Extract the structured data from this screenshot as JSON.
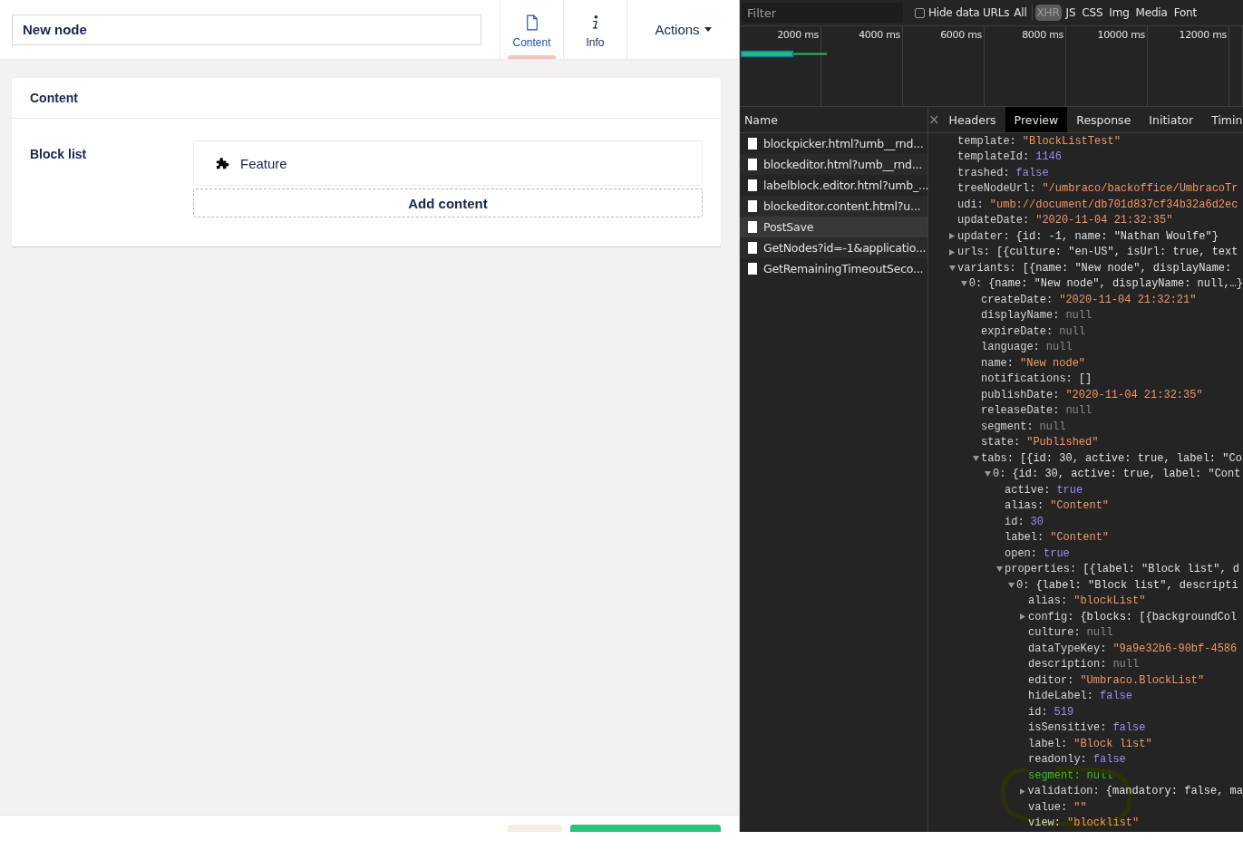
{
  "editor": {
    "name_field": {
      "value": "New node"
    },
    "tabs": [
      {
        "label": "Content",
        "selected": true
      },
      {
        "label": "Info",
        "selected": false
      }
    ],
    "actions_button": "Actions",
    "group": {
      "title": "Content",
      "property": {
        "label": "Block list",
        "blocks": [
          {
            "label": "Feature"
          }
        ],
        "add_button": "Add content"
      }
    },
    "footer_buttons": [
      {
        "kind": "secondary"
      },
      {
        "kind": "primary"
      }
    ]
  },
  "devtools": {
    "filter": {
      "placeholder": "Filter"
    },
    "hide_data_urls": {
      "label": "Hide data URLs",
      "checked": false
    },
    "type_filters": [
      {
        "label": "All",
        "selected": false
      },
      {
        "label": "XHR",
        "selected": true
      },
      {
        "label": "JS",
        "selected": false
      },
      {
        "label": "CSS",
        "selected": false
      },
      {
        "label": "Img",
        "selected": false
      },
      {
        "label": "Media",
        "selected": false
      },
      {
        "label": "Font",
        "selected": false
      }
    ],
    "timeline_ticks": [
      "2000 ms",
      "4000 ms",
      "6000 ms",
      "8000 ms",
      "10000 ms",
      "12000 ms"
    ],
    "requests": {
      "column": "Name",
      "rows": [
        {
          "name": "blockpicker.html?umb__rnd...",
          "selected": false
        },
        {
          "name": "blockeditor.html?umb__rnd...",
          "selected": false
        },
        {
          "name": "labelblock.editor.html?umb_...",
          "selected": false
        },
        {
          "name": "blockeditor.content.html?u...",
          "selected": false
        },
        {
          "name": "PostSave",
          "selected": true
        },
        {
          "name": "GetNodes?id=-1&applicatio...",
          "selected": false
        },
        {
          "name": "GetRemainingTimeoutSeco...",
          "selected": false
        }
      ]
    },
    "detail_close": "×",
    "detail_tabs": [
      {
        "label": "Headers",
        "selected": false
      },
      {
        "label": "Preview",
        "selected": true
      },
      {
        "label": "Response",
        "selected": false
      },
      {
        "label": "Initiator",
        "selected": false
      },
      {
        "label": "Timin",
        "selected": false
      }
    ],
    "preview": [
      {
        "key": "template:",
        "value": "\"BlockListTest\"",
        "kind": "string"
      },
      {
        "key": "templateId:",
        "value": "1146",
        "kind": "number"
      },
      {
        "key": "trashed:",
        "value": "false",
        "kind": "boolean"
      },
      {
        "key": "treeNodeUrl:",
        "value": "\"/umbraco/backoffice/UmbracoTr",
        "kind": "string"
      },
      {
        "key": "udi:",
        "value": "\"umb://document/db701d837cf34b32a6d2ec",
        "kind": "string"
      },
      {
        "key": "updateDate:",
        "value": "\"2020-11-04 21:32:35\"",
        "kind": "string"
      },
      {
        "key": "updater:",
        "value": "{id: -1, name: \"Nathan Woulfe\"}",
        "kind": "object",
        "expanded": false
      },
      {
        "key": "urls:",
        "value": "[{culture: \"en-US\", isUrl: true, text",
        "kind": "object",
        "expanded": false
      },
      {
        "key": "variants:",
        "value": "[{name: \"New node\", displayName:",
        "kind": "object",
        "expanded": true,
        "children": [
          {
            "key": "0:",
            "value": "{name: \"New node\", displayName: null,…}",
            "kind": "object",
            "expanded": true,
            "children": [
              {
                "key": "createDate:",
                "value": "\"2020-11-04 21:32:21\"",
                "kind": "string"
              },
              {
                "key": "displayName:",
                "value": "null",
                "kind": "null"
              },
              {
                "key": "expireDate:",
                "value": "null",
                "kind": "null"
              },
              {
                "key": "language:",
                "value": "null",
                "kind": "null"
              },
              {
                "key": "name:",
                "value": "\"New node\"",
                "kind": "string"
              },
              {
                "key": "notifications:",
                "value": "[]",
                "kind": "object"
              },
              {
                "key": "publishDate:",
                "value": "\"2020-11-04 21:32:35\"",
                "kind": "string"
              },
              {
                "key": "releaseDate:",
                "value": "null",
                "kind": "null"
              },
              {
                "key": "segment:",
                "value": "null",
                "kind": "null"
              },
              {
                "key": "state:",
                "value": "\"Published\"",
                "kind": "string"
              },
              {
                "key": "tabs:",
                "value": "[{id: 30, active: true, label: \"Co",
                "kind": "object",
                "expanded": true,
                "children": [
                  {
                    "key": "0:",
                    "value": "{id: 30, active: true, label: \"Cont",
                    "kind": "object",
                    "expanded": true,
                    "children": [
                      {
                        "key": "active:",
                        "value": "true",
                        "kind": "boolean"
                      },
                      {
                        "key": "alias:",
                        "value": "\"Content\"",
                        "kind": "string"
                      },
                      {
                        "key": "id:",
                        "value": "30",
                        "kind": "number"
                      },
                      {
                        "key": "label:",
                        "value": "\"Content\"",
                        "kind": "string"
                      },
                      {
                        "key": "open:",
                        "value": "true",
                        "kind": "boolean"
                      },
                      {
                        "key": "properties:",
                        "value": "[{label: \"Block list\", d",
                        "kind": "object",
                        "expanded": true,
                        "children": [
                          {
                            "key": "0:",
                            "value": "{label: \"Block list\", descripti",
                            "kind": "object",
                            "expanded": true,
                            "children": [
                              {
                                "key": "alias:",
                                "value": "\"blockList\"",
                                "kind": "string"
                              },
                              {
                                "key": "config:",
                                "value": "{blocks: [{backgroundCol",
                                "kind": "object",
                                "expanded": false
                              },
                              {
                                "key": "culture:",
                                "value": "null",
                                "kind": "null"
                              },
                              {
                                "key": "dataTypeKey:",
                                "value": "\"9a9e32b6-90bf-4586",
                                "kind": "string"
                              },
                              {
                                "key": "description:",
                                "value": "null",
                                "kind": "null"
                              },
                              {
                                "key": "editor:",
                                "value": "\"Umbraco.BlockList\"",
                                "kind": "string"
                              },
                              {
                                "key": "hideLabel:",
                                "value": "false",
                                "kind": "boolean"
                              },
                              {
                                "key": "id:",
                                "value": "519",
                                "kind": "number"
                              },
                              {
                                "key": "isSensitive:",
                                "value": "false",
                                "kind": "boolean"
                              },
                              {
                                "key": "label:",
                                "value": "\"Block list\"",
                                "kind": "string"
                              },
                              {
                                "key": "readonly:",
                                "value": "false",
                                "kind": "boolean"
                              },
                              {
                                "key": "segment:",
                                "value": "null",
                                "kind": "null",
                                "highlighted": true
                              },
                              {
                                "key": "validation:",
                                "value": "{mandatory: false, ma",
                                "kind": "object",
                                "expanded": false
                              },
                              {
                                "key": "value:",
                                "value": "\"\"",
                                "kind": "string"
                              },
                              {
                                "key": "view:",
                                "value": "\"blocklist\"",
                                "kind": "string"
                              }
                            ]
                          }
                        ]
                      }
                    ]
                  }
                ]
              }
            ]
          }
        ]
      }
    ]
  }
}
